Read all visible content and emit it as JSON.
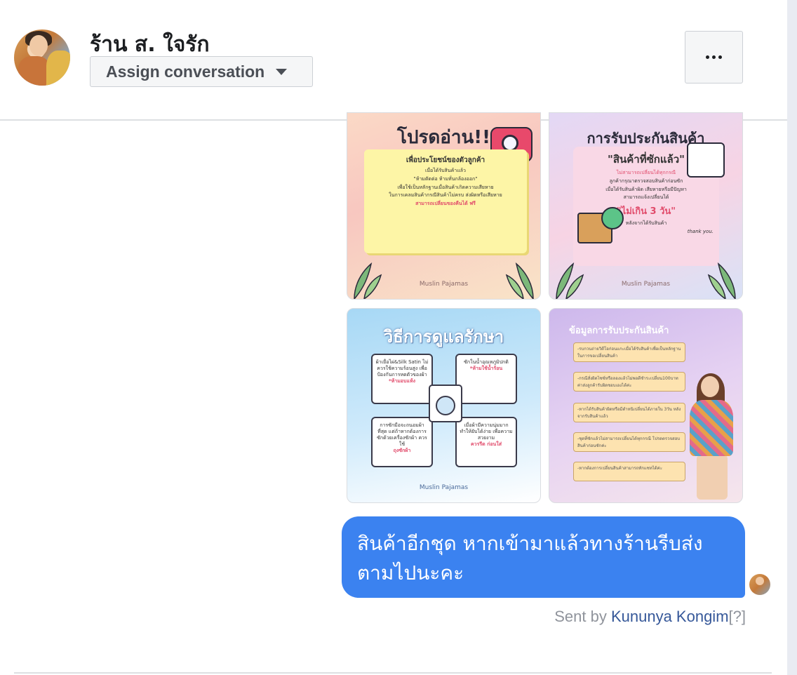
{
  "header": {
    "page_name": "ร้าน ส. ใจรัก",
    "assign_label": "Assign conversation",
    "more_label": "..."
  },
  "images": [
    {
      "title": "โปรดอ่าน!!",
      "heading": "เพื่อประโยชน์ของตัวลูกค้า",
      "lines": [
        "เมื่อได้รับสินค้าแล้ว",
        "\"ห้ามตัดต่อ ห้ามหั่นกล้องออก\"",
        "เพื่อใช้เป็นหลักฐานเมื่อสินค้าเกิดความเสียหาย",
        "ในการเคลมสินค้ากรณีสินค้าไม่ครบ ส่งผิดหรือเสียหาย",
        "สามารถเปลี่ยนของคืนได้ ฟรี"
      ],
      "brand": "Muslin Pajamas"
    },
    {
      "title": "การรับประกันสินค้า",
      "heading": "\"สินค้าที่ซักแล้ว\"",
      "lines": [
        "ไม่สามารถเปลี่ยนได้ทุกกรณี",
        "ลูกค้ากรุณาตรวจสอบสินค้าก่อนซัก",
        "เมื่อได้รับสินค้าผิด เสียหายหรือมีปัญหา",
        "สามารถแจ้งเปลี่ยนได้"
      ],
      "highlight": "\"ไม่เกิน 3 วัน\"",
      "after": "หลังจากได้รับสินค้า",
      "thanks": "thank you.",
      "brand": "Muslin Pajamas"
    },
    {
      "title": "วิธีการดูแลรักษา",
      "cards": [
        {
          "text": "ผ้าเยื่อไผ่&Silk Satin ไม่ควรใช้ความร้อนสูง เพื่อป้องกันการหดตัวของผ้า",
          "red": "*ห้ามอบแห้ง"
        },
        {
          "text": "ซักในน้ำอุณหภูมิปกติ",
          "red": "*ห้ามใช้น้ำร้อน"
        },
        {
          "text": "การซักมือจะถนอมผ้าที่สุด แต่ถ้าหากต้องการซักด้วยเครื่องซักผ้า ควรใช้",
          "red": "ถุงซักผ้า"
        },
        {
          "text": "เมื่อผ้ามีความนุ่มมาก ทำให้ยับได้ง่าย เพื่อความสวยงาม",
          "red": "ควรรีด ก่อนใส่"
        }
      ],
      "brand": "Muslin Pajamas"
    },
    {
      "title": "ข้อมูลการรับประกันสินค้า",
      "rows": [
        "-รบกวนถ่ายวิดีโอก่อนแกะเมื่อได้รับสินค้าเพื่อเป็นหลักฐานในการขอเปลี่ยนสินค้า",
        "-กรณีสั่งผิดไซซ์หรือลองแล้วไม่พอดีชำระเปลี่ยน100บาท ค่าส่งลูกค้ารับผิดชอบเองได้ค่ะ",
        "-หากได้รับสินค้าผิดหรือมีตำหนิเปลี่ยนได้ภายใน 3วัน หลังจากรับสินค้าแล้ว",
        "-ชุดที่ซักแล้วไม่สามารถเปลี่ยนได้ทุกกรณี โปรดตรวจสอบสินค้าก่อนซักค่ะ",
        "-หากต้องการเปลี่ยนสินค้าสามารถทักแชทได้ค่ะ"
      ]
    }
  ],
  "message": {
    "text": "สินค้าอีกชุด หากเข้ามาแล้วทางร้านรีบส่งตามไปนะคะ",
    "sent_prefix": "Sent by ",
    "sender": "Kununya Kongim",
    "help": "[?]"
  }
}
